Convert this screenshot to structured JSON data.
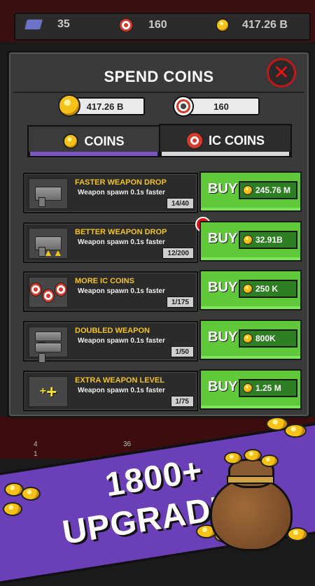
{
  "topbar": {
    "gems": "35",
    "ic_coins": "160",
    "coins": "417.26 B"
  },
  "panel": {
    "title": "SPEND COINS",
    "close_label": "✕",
    "balances": {
      "coins": "417.26 B",
      "ic_coins": "160"
    },
    "tabs": [
      {
        "label": "COINS",
        "active": true
      },
      {
        "label": "IC COINS",
        "active": false
      }
    ]
  },
  "upgrades": [
    {
      "name": "FASTER WEAPON DROP",
      "desc": "Weapon spawn 0.1s faster",
      "progress": "14/40",
      "buy_label": "BUY",
      "price": "245.76 M",
      "alert": false,
      "icon": "pistol-icon"
    },
    {
      "name": "BETTER WEAPON DROP",
      "desc": "Weapon spawn 0.1s faster",
      "progress": "12/200",
      "buy_label": "BUY",
      "price": "32.91B",
      "alert": true,
      "alert_label": "!",
      "icon": "pistol-upgrade-icon"
    },
    {
      "name": "MORE IC COINS",
      "desc": "Weapon spawn 0.1s faster",
      "progress": "1/175",
      "buy_label": "BUY",
      "price": "250 K",
      "alert": false,
      "icon": "ic-coins-icon"
    },
    {
      "name": "DOUBLED WEAPON",
      "desc": "Weapon spawn 0.1s faster",
      "progress": "1/50",
      "buy_label": "BUY",
      "price": "800K",
      "alert": false,
      "icon": "double-pistol-icon"
    },
    {
      "name": "EXTRA WEAPON LEVEL",
      "desc": "Weapon spawn 0.1s faster",
      "progress": "1/75",
      "buy_label": "BUY",
      "price": "1.25 M",
      "alert": false,
      "icon": "plus-icon"
    }
  ],
  "background": {
    "stat1": "4",
    "stat2": "1",
    "stat3": "36"
  },
  "promo": {
    "line1": "1800+",
    "line2": "UPGRADES!"
  },
  "colors": {
    "buy_green": "#5fc93a",
    "accent_purple": "#6b3fb8",
    "title_yellow": "#f2c321"
  }
}
